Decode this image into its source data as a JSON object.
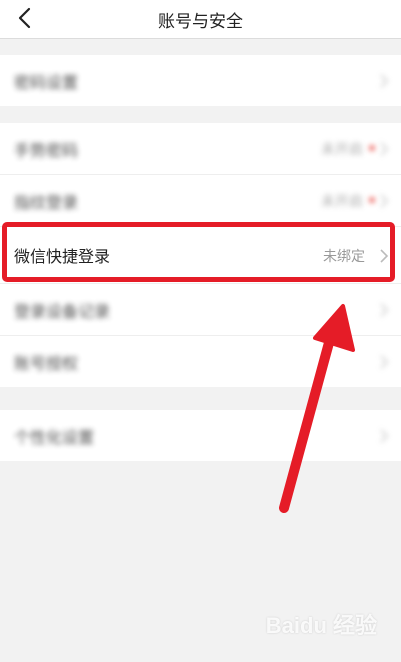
{
  "header": {
    "title": "账号与安全",
    "back_icon": "chevron-left-icon"
  },
  "group1": [
    {
      "label": "密码设置"
    }
  ],
  "group2": [
    {
      "label": "手势密码",
      "value": "未开启"
    },
    {
      "label": "指纹登录",
      "value": "未开启"
    },
    {
      "label": "微信快捷登录",
      "value": "未绑定"
    },
    {
      "label": "登录设备记录"
    },
    {
      "label": "账号授权"
    }
  ],
  "group3": [
    {
      "label": "个性化设置"
    }
  ],
  "annotation": {
    "highlight_color": "#e51c27"
  },
  "watermark": {
    "text": "Baidu 经验"
  }
}
